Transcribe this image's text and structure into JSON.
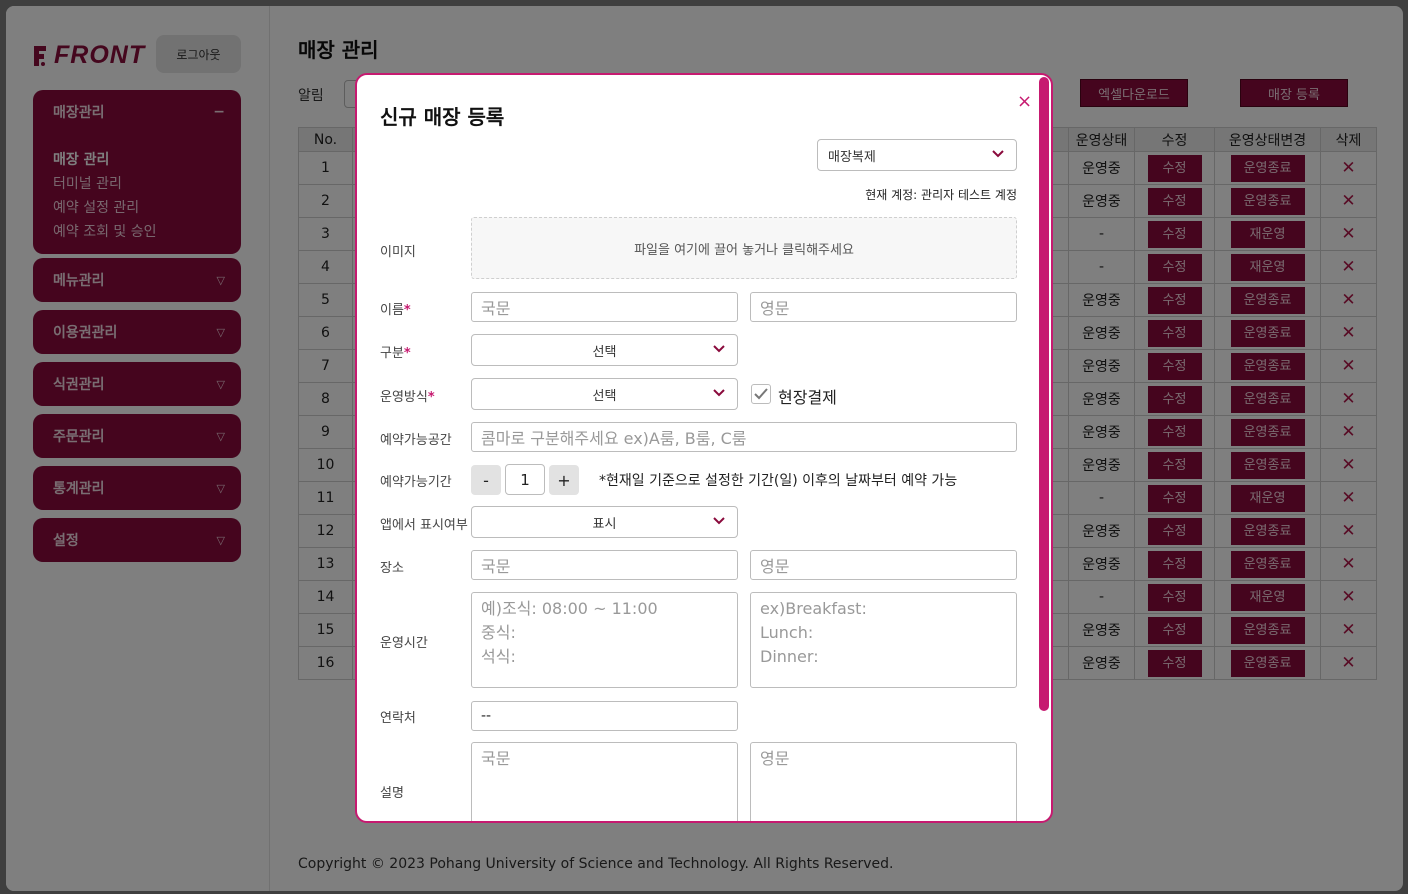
{
  "app": {
    "logo_text": "FRONT",
    "logout_label": "로그아웃"
  },
  "sidebar": {
    "groups": [
      {
        "label": "매장관리",
        "toggle": "−",
        "items": [
          "매장 관리",
          "터미널 관리",
          "예약 설정 관리",
          "예약 조회 및 승인"
        ],
        "active_item": "매장 관리"
      },
      {
        "label": "메뉴관리"
      },
      {
        "label": "이용권관리"
      },
      {
        "label": "식권관리"
      },
      {
        "label": "주문관리"
      },
      {
        "label": "통계관리"
      },
      {
        "label": "설정"
      }
    ]
  },
  "main": {
    "title": "매장 관리",
    "alarm_label": "알림",
    "excel_button": "엑셀다운로드",
    "register_button": "매장 등록",
    "table": {
      "headers": {
        "no": "No.",
        "status": "운영상태",
        "edit": "수정",
        "change": "운영상태변경",
        "delete": "삭제"
      },
      "edit_label": "수정",
      "delete_symbol": "✕",
      "rows": [
        {
          "no": "1",
          "status": "운영중",
          "change": "운영종료"
        },
        {
          "no": "2",
          "status": "운영중",
          "change": "운영종료"
        },
        {
          "no": "3",
          "status": "-",
          "change": "재운영"
        },
        {
          "no": "4",
          "status": "-",
          "change": "재운영"
        },
        {
          "no": "5",
          "status": "운영중",
          "change": "운영종료"
        },
        {
          "no": "6",
          "status": "운영중",
          "change": "운영종료"
        },
        {
          "no": "7",
          "status": "운영중",
          "change": "운영종료"
        },
        {
          "no": "8",
          "status": "운영중",
          "change": "운영종료"
        },
        {
          "no": "9",
          "status": "운영중",
          "change": "운영종료"
        },
        {
          "no": "10",
          "status": "운영중",
          "change": "운영종료"
        },
        {
          "no": "11",
          "status": "-",
          "change": "재운영"
        },
        {
          "no": "12",
          "status": "운영중",
          "change": "운영종료"
        },
        {
          "no": "13",
          "status": "운영중",
          "change": "운영종료"
        },
        {
          "no": "14",
          "status": "-",
          "change": "재운영"
        },
        {
          "no": "15",
          "status": "운영중",
          "change": "운영종료"
        },
        {
          "no": "16",
          "status": "운영중",
          "change": "운영종료"
        }
      ]
    },
    "footer": "Copyright © 2023 Pohang University of Science and Technology. All Rights Reserved."
  },
  "modal": {
    "title": "신규 매장 등록",
    "close_symbol": "×",
    "copy_select": "매장복제",
    "current_account": "현재 계정: 관리자 테스트 계정",
    "labels": {
      "image": "이미지",
      "name": "이름",
      "category": "구분",
      "operation": "운영방식",
      "space": "예약가능공간",
      "period": "예약가능기간",
      "app_display": "앱에서 표시여부",
      "place": "장소",
      "hours": "운영시간",
      "contact": "연락처",
      "description": "설명"
    },
    "required_mark": "*",
    "dropzone_text": "파일을 여기에 끌어 놓거나 클릭해주세요",
    "name_ko_placeholder": "국문",
    "name_en_placeholder": "영문",
    "category_value": "선택",
    "operation_value": "선택",
    "onsite_payment_label": "현장결제",
    "onsite_payment_checked": true,
    "space_placeholder": "콤마로 구분해주세요 ex)A룸, B룸, C룸",
    "period": {
      "minus": "-",
      "value": "1",
      "plus": "+",
      "note": "*현재일 기준으로 설정한 기간(일) 이후의 날짜부터 예약 가능"
    },
    "app_display_value": "표시",
    "place_ko_placeholder": "국문",
    "place_en_placeholder": "영문",
    "hours_ko_placeholder": [
      "예)조식: 08:00 ~ 11:00",
      "중식:",
      "석식:"
    ],
    "hours_en_placeholder": [
      "ex)Breakfast:",
      "Lunch:",
      "Dinner:"
    ],
    "contact_value": "--",
    "desc_ko_placeholder": "국문",
    "desc_en_placeholder": "영문"
  },
  "colors": {
    "brand": "#8a0a3c",
    "accent": "#c61a70"
  }
}
